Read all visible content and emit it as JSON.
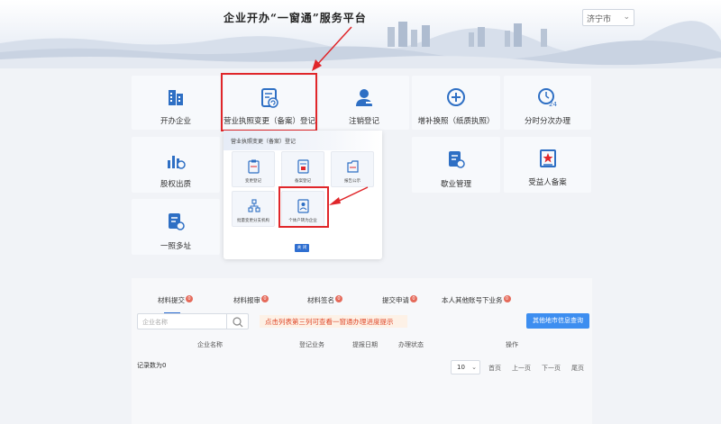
{
  "header": {
    "title": "企业开办“一窗通”服务平台",
    "city": "济宁市"
  },
  "tiles": {
    "start_business": "开办企业",
    "change_registration": "营业执照变更（备案）登记",
    "deregistration": "注销登记",
    "reissue_license": "增补换照（纸质执照）",
    "time_slot": "分时分次办理",
    "equity_pledge": "股权出质",
    "enterprise_management": "歇业管理",
    "beneficial_owner": "受益人备案",
    "one_address_multi": "一照多址"
  },
  "popup": {
    "title": "营业执照变更（备案）登记",
    "items": {
      "change_reg": "变更登记",
      "filing_reg": "备案登记",
      "info_disclosure": "报告公示",
      "branch_change": "批量变更分支机构",
      "individual_to_enterprise": "个体户转为企业"
    },
    "close_label": "关 闭"
  },
  "panel": {
    "tabs": {
      "material_submit": "材料提交",
      "material_review": "材料报审",
      "material_sign": "材料签名",
      "submit_apply": "提交申请",
      "other_tax": "本人其他账号下业务"
    },
    "search_placeholder": "企业名称",
    "hint": "点击列表第三列可查看一窗通办理进度提示",
    "query_button": "其他地市信息查询",
    "columns": {
      "company": "企业名称",
      "business": "登记业务",
      "date": "提报日期",
      "status": "办理状态",
      "action": "操作"
    },
    "record_count": "记录数为0",
    "page_size": "10",
    "pager": {
      "first": "首页",
      "prev": "上一页",
      "next": "下一页",
      "last": "尾页"
    }
  },
  "colors": {
    "accent": "#2f6fd1",
    "highlight": "#e0262a",
    "icon": "#2e6fc4"
  }
}
